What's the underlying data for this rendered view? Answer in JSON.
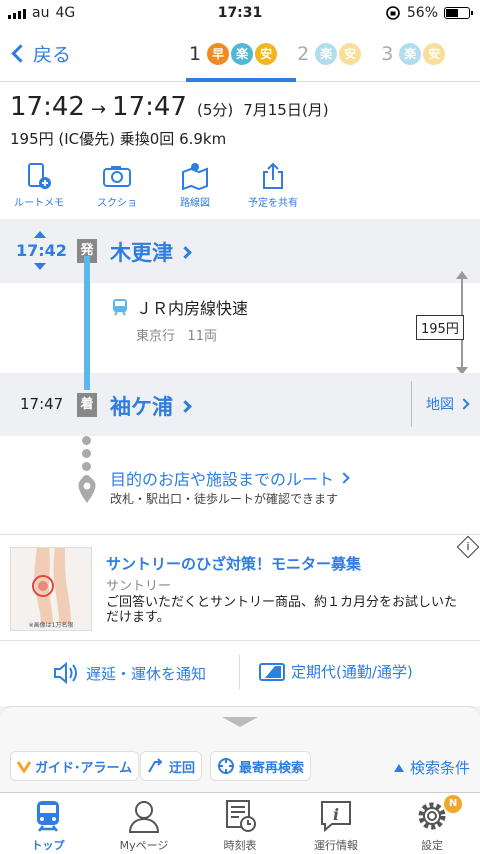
{
  "status": {
    "carrier": "au",
    "network": "4G",
    "time": "17:31",
    "battery": "56%",
    "battery_level": 0.56
  },
  "nav": {
    "back_label": "戻る",
    "routes": [
      {
        "num": "1",
        "chips": [
          "早",
          "楽",
          "安"
        ],
        "active": true
      },
      {
        "num": "2",
        "chips": [
          "楽",
          "安"
        ],
        "active": false
      },
      {
        "num": "3",
        "chips": [
          "楽",
          "安"
        ],
        "active": false
      }
    ]
  },
  "summary": {
    "dep_time": "17:42",
    "arrow": "→",
    "arr_time": "17:47",
    "duration": "(5分)",
    "date": "7月15日(月)",
    "fare_line": "195円 (IC優先) 乗換0回 6.9km",
    "actions": [
      {
        "label": "ルートメモ",
        "icon": "memo-phone-icon"
      },
      {
        "label": "スクショ",
        "icon": "camera-icon"
      },
      {
        "label": "路線図",
        "icon": "route-map-icon"
      },
      {
        "label": "予定を共有",
        "icon": "share-icon"
      }
    ]
  },
  "timeline": {
    "departure": {
      "time": "17:42",
      "badge": "発",
      "station": "木更津"
    },
    "train": {
      "name": "ＪＲ内房線快速",
      "direction": "東京行",
      "cars": "11両",
      "fare": "195円"
    },
    "arrival": {
      "time": "17:47",
      "badge": "着",
      "station": "袖ケ浦",
      "map_label": "地図"
    },
    "destination": {
      "link": "目的のお店や施設までのルート",
      "sub": "改札・駅出口・徒歩ルートが確認できます"
    }
  },
  "ad": {
    "title": "サントリーのひざ対策！モニター募集",
    "sponsor": "サントリー",
    "text": "ご回答いただくとサントリー商品、約１カ月分をお試しいただけます。",
    "image_caption": "※画像は1万名限",
    "info_glyph": "i"
  },
  "notify": {
    "delay_label": "遅延・運休を通知",
    "pass_label": "定期代(通勤/通学)"
  },
  "drawer": {
    "guide_label": "ガイド･アラーム",
    "detour_label": "迂回",
    "research_label": "最寄再検索",
    "cond_label": "検索条件"
  },
  "tabbar": [
    {
      "label": "トップ",
      "icon": "train-icon",
      "active": true
    },
    {
      "label": "Myページ",
      "icon": "person-icon",
      "active": false
    },
    {
      "label": "時刻表",
      "icon": "timetable-icon",
      "active": false
    },
    {
      "label": "運行情報",
      "icon": "info-icon",
      "active": false
    },
    {
      "label": "設定",
      "icon": "gear-icon",
      "active": false,
      "badge": "N"
    }
  ],
  "colors": {
    "accent": "#2f7de1",
    "line": "#5bb8ea",
    "fast": "#f08a24",
    "easy": "#53b6d6",
    "cheap": "#f2b51e"
  }
}
